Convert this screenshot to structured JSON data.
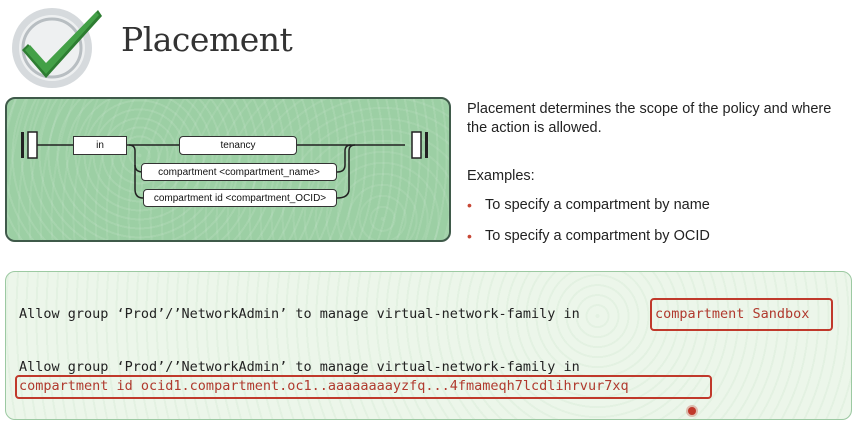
{
  "header": {
    "title": "Placement"
  },
  "diagram": {
    "in_label": "in",
    "tenancy_label": "tenancy",
    "compartment_name_label": "compartment <compartment_name>",
    "compartment_id_label": "compartment id <compartment_OCID>"
  },
  "description": {
    "text": "Placement determines the scope of the policy and where the action is allowed.",
    "examples_label": "Examples:",
    "examples": [
      "To specify a compartment by name",
      "To specify a compartment by OCID"
    ]
  },
  "code": {
    "line1_prefix": "Allow group ‘Prod’/’NetworkAdmin’ to manage virtual-network-family in",
    "line1_highlight": "compartment Sandbox",
    "line2_prefix": "Allow group ‘Prod’/’NetworkAdmin’ to manage virtual-network-family in",
    "line2_highlight": "compartment id ocid1.compartment.oc1..aaaaaaaayzfq...4fmameqh7lcdlihrvur7xq"
  },
  "colors": {
    "accent_green": "#4caf50",
    "highlight_red": "#c0392b",
    "bullet_red": "#c74634"
  },
  "icons": {
    "logo": "checkmark-badge-icon"
  }
}
